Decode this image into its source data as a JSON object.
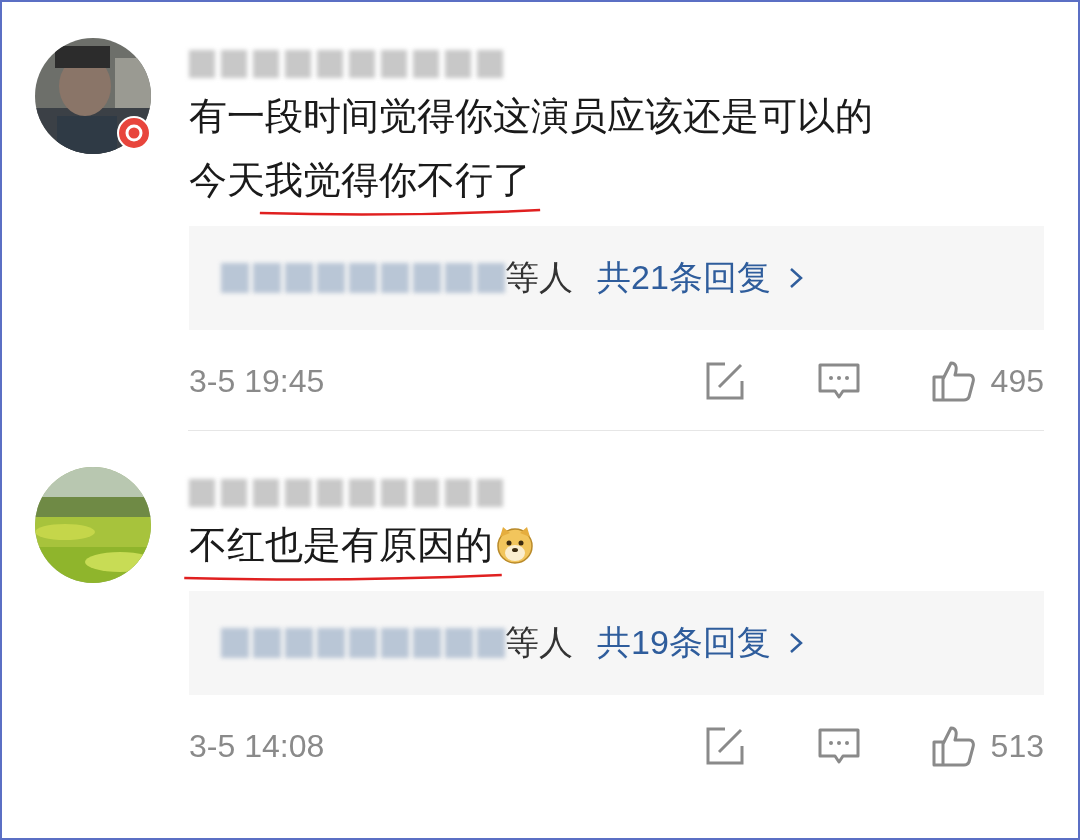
{
  "comments": [
    {
      "avatar": {
        "kind": "picture",
        "badge": true
      },
      "lines": [
        [
          {
            "text": "有一段时间觉得你这演员应该还是可以的",
            "underlined": false
          }
        ],
        [
          {
            "text": "今天",
            "underlined": false
          },
          {
            "text": "我觉得你不行了",
            "underlined": true
          }
        ]
      ],
      "emoji": false,
      "reply": {
        "suffix": "等人",
        "count": "共21条回复"
      },
      "time": "3-5 19:45",
      "likes": "495"
    },
    {
      "avatar": {
        "kind": "picture",
        "badge": false
      },
      "lines": [
        [
          {
            "text": "不红也是有原因的",
            "underlined": true
          }
        ]
      ],
      "emoji": true,
      "reply": {
        "suffix": "等人",
        "count": "共19条回复"
      },
      "time": "3-5 14:08",
      "likes": "513"
    }
  ]
}
